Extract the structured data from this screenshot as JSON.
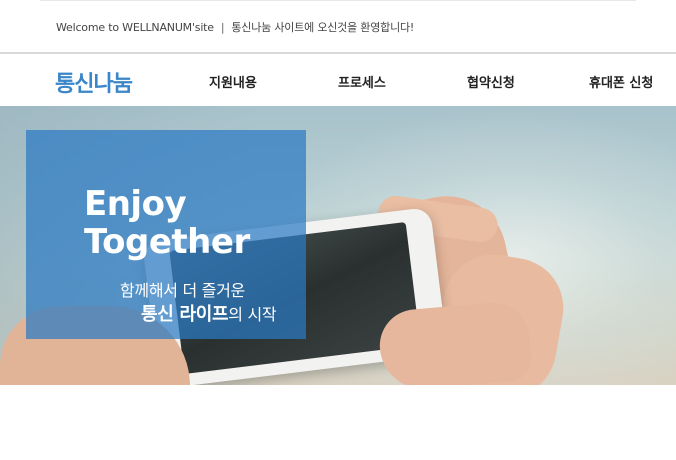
{
  "topbar": {
    "welcome_text": "Welcome to WELLNANUM'site",
    "separator": "|",
    "greeting": "통신나눔 사이트에 오신것을 환영합니다!"
  },
  "nav": {
    "logo": "통신나눔",
    "items": [
      {
        "label": "지원내용"
      },
      {
        "label": "프로세스"
      },
      {
        "label": "협약신청"
      },
      {
        "label": "휴대폰 신청"
      }
    ]
  },
  "hero": {
    "title_line1": "Enjoy",
    "title_line2": "Together",
    "subtitle_line1": "함께해서 더 즐거운",
    "subtitle_line2_bold": "통신 라이프",
    "subtitle_line2_rest": "의 시작",
    "box_color": "#2b7ac4"
  },
  "colors": {
    "logo": "#3a86c8",
    "nav_text": "#222222"
  }
}
